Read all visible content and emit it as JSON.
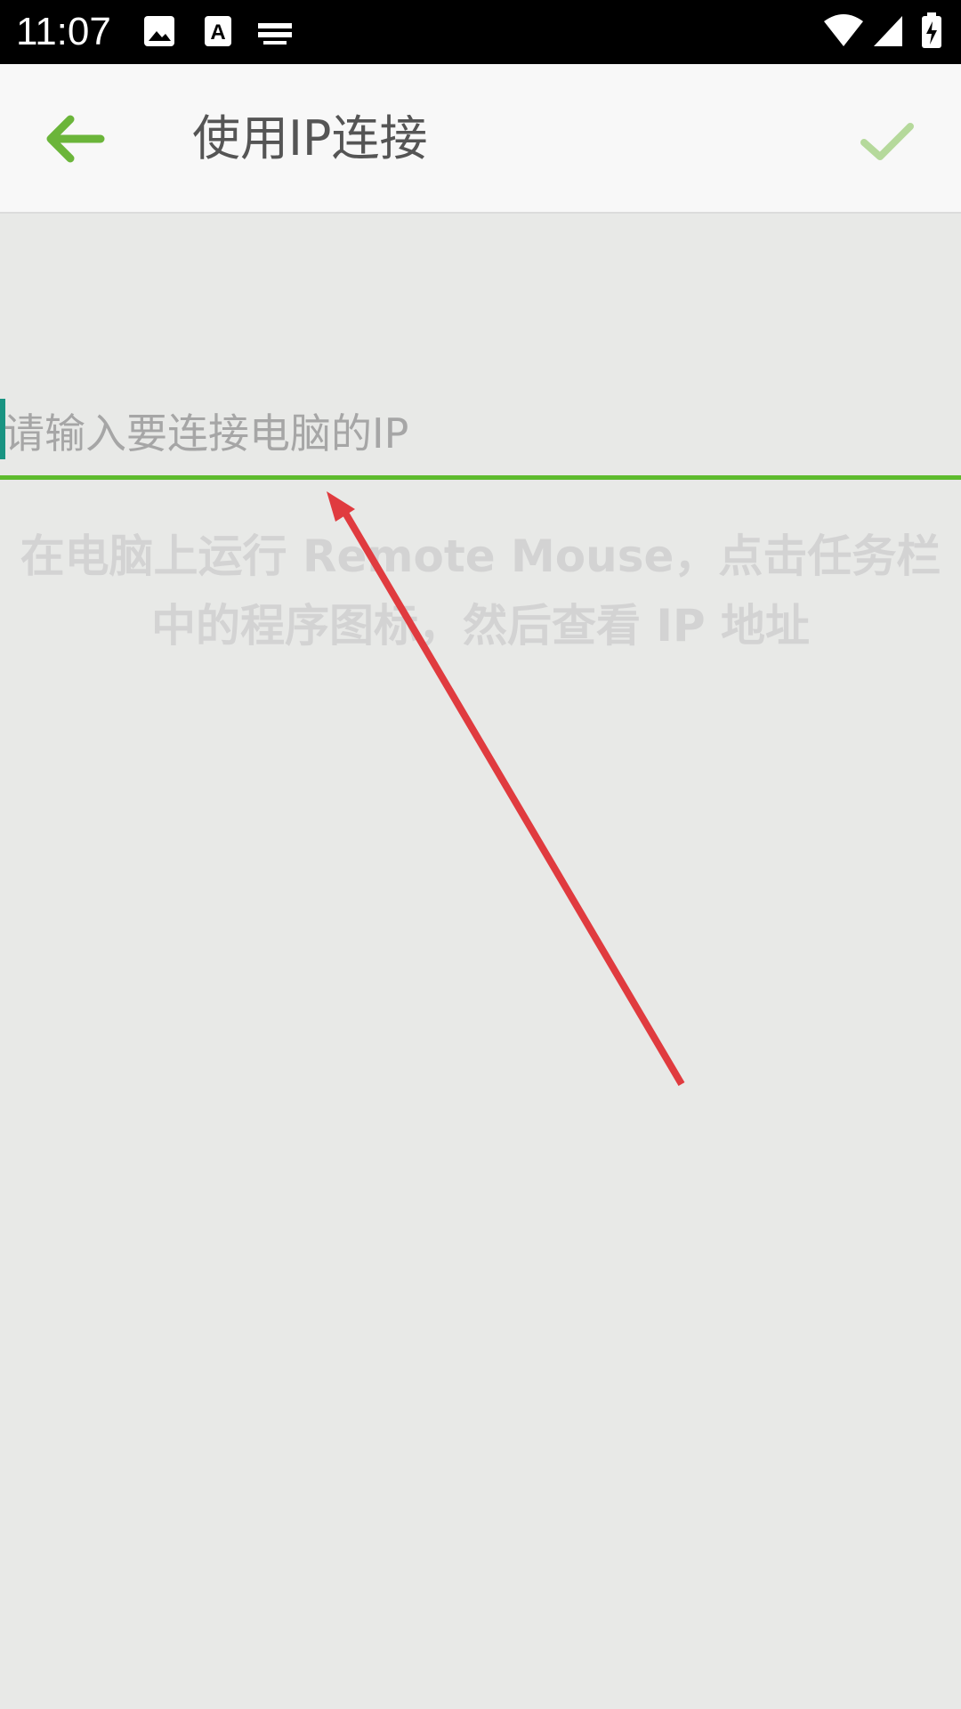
{
  "status_bar": {
    "time": "11:07",
    "left_icons": [
      "image-icon",
      "font-a-icon",
      "keyboard-icon"
    ],
    "right_icons": [
      "wifi-icon",
      "signal-icon",
      "battery-charging-icon"
    ]
  },
  "app_bar": {
    "title": "使用IP连接",
    "back_icon": "arrow-left-icon",
    "confirm_icon": "check-icon",
    "accent_color": "#6bb53a",
    "confirm_color": "#b5d99b"
  },
  "ip_field": {
    "value": "",
    "placeholder": "请输入要连接电脑的IP",
    "underline_color": "#5dbb2d",
    "cursor_color": "#199482"
  },
  "hint": {
    "text": "在电脑上运行 Remote Mouse，点击任务栏中的程序图标，然后查看 IP 地址"
  },
  "annotation": {
    "type": "arrow",
    "color": "#e03b3f"
  }
}
